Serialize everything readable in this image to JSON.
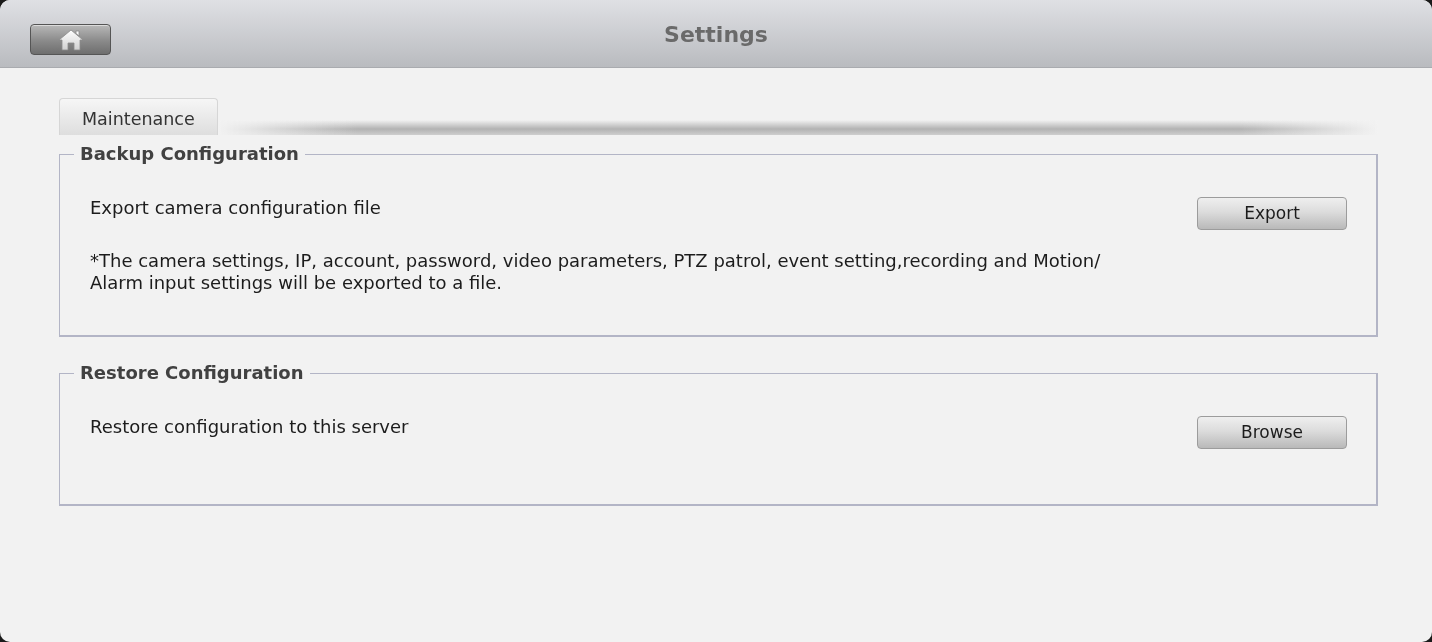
{
  "window": {
    "title": "Settings"
  },
  "tabs": [
    {
      "label": "Maintenance",
      "selected": true
    }
  ],
  "sections": [
    {
      "title": "Backup Configuration",
      "description": "Export camera configuration file",
      "button": "Export",
      "note": "*The camera settings, IP, account, password, video parameters, PTZ patrol, event setting,recording and Motion/Alarm input settings will be exported to a file."
    },
    {
      "title": "Restore Configuration",
      "description": "Restore configuration to this server",
      "button": "Browse"
    }
  ]
}
